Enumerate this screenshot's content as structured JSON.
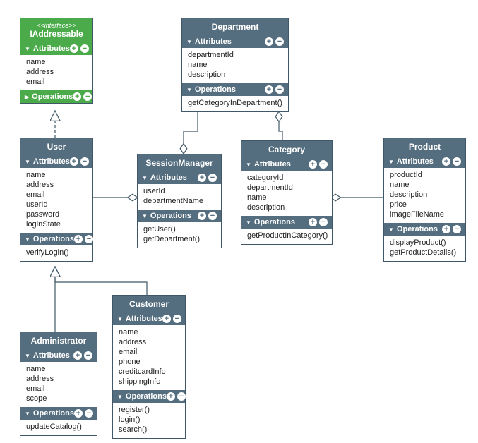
{
  "iaddressable": {
    "stereotype": "<<interface>>",
    "title": "IAddressable",
    "attributes_label": "Attributes",
    "attributes": [
      "name",
      "address",
      "email"
    ],
    "operations_label": "Operations"
  },
  "department": {
    "title": "Department",
    "attributes_label": "Attributes",
    "attributes": [
      "departmentId",
      "name",
      "description"
    ],
    "operations_label": "Operations",
    "operations": [
      "getCategoryInDepartment()"
    ]
  },
  "user": {
    "title": "User",
    "attributes_label": "Attributes",
    "attributes": [
      "name",
      "address",
      "email",
      "userId",
      "password",
      "loginState"
    ],
    "operations_label": "Operations",
    "operations": [
      "verifyLogin()"
    ]
  },
  "sessionmanager": {
    "title": "SessionManager",
    "attributes_label": "Attributes",
    "attributes": [
      "userId",
      "departmentName"
    ],
    "operations_label": "Operations",
    "operations": [
      "getUser()",
      "getDepartment()"
    ]
  },
  "category": {
    "title": "Category",
    "attributes_label": "Attributes",
    "attributes": [
      "categoryId",
      "departmentId",
      "name",
      "description"
    ],
    "operations_label": "Operations",
    "operations": [
      "getProductInCategory()"
    ]
  },
  "product": {
    "title": "Product",
    "attributes_label": "Attributes",
    "attributes": [
      "productId",
      "name",
      "description",
      "price",
      "imageFileName"
    ],
    "operations_label": "Operations",
    "operations": [
      "displayProduct()",
      "getProductDetails()"
    ]
  },
  "administrator": {
    "title": "Administrator",
    "attributes_label": "Attributes",
    "attributes": [
      "name",
      "address",
      "email",
      "scope"
    ],
    "operations_label": "Operations",
    "operations": [
      "updateCatalog()"
    ]
  },
  "customer": {
    "title": "Customer",
    "attributes_label": "Attributes",
    "attributes": [
      "name",
      "address",
      "email",
      "phone",
      "creditcardInfo",
      "shippingInfo"
    ],
    "operations_label": "Operations",
    "operations": [
      "register()",
      "login()",
      "search()"
    ]
  }
}
